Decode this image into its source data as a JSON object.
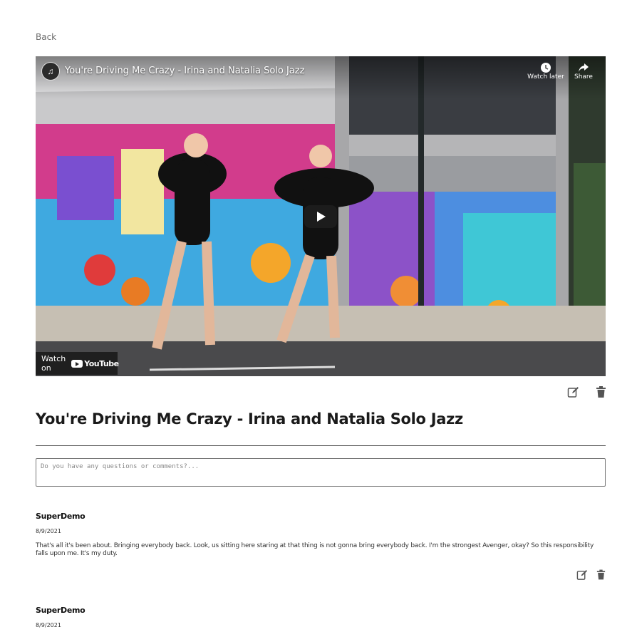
{
  "nav": {
    "back_label": "Back"
  },
  "video": {
    "embed_title": "You're Driving Me Crazy - Irina and Natalia Solo Jazz",
    "watch_later_label": "Watch later",
    "share_label": "Share",
    "watch_on_label": "Watch on",
    "youtube_label": "YouTube",
    "play_icon": "play-icon"
  },
  "post": {
    "title": "You're Driving Me Crazy - Irina and Natalia Solo Jazz",
    "edit_icon": "edit-icon",
    "delete_icon": "trash-icon"
  },
  "comment_input": {
    "placeholder": "Do you have any questions or comments?...",
    "value": ""
  },
  "comments": [
    {
      "author": "SuperDemo",
      "date": "8/9/2021",
      "text": "That's all it's been about. Bringing everybody back. Look, us sitting here staring at that thing is not gonna bring everybody back. I'm the strongest Avenger, okay? So this responsibility falls upon me. It's my duty."
    },
    {
      "author": "SuperDemo",
      "date": "8/9/2021",
      "text": ""
    }
  ],
  "colors": {
    "icon": "#555555",
    "text": "#111111",
    "muted": "#6b6b6b"
  }
}
